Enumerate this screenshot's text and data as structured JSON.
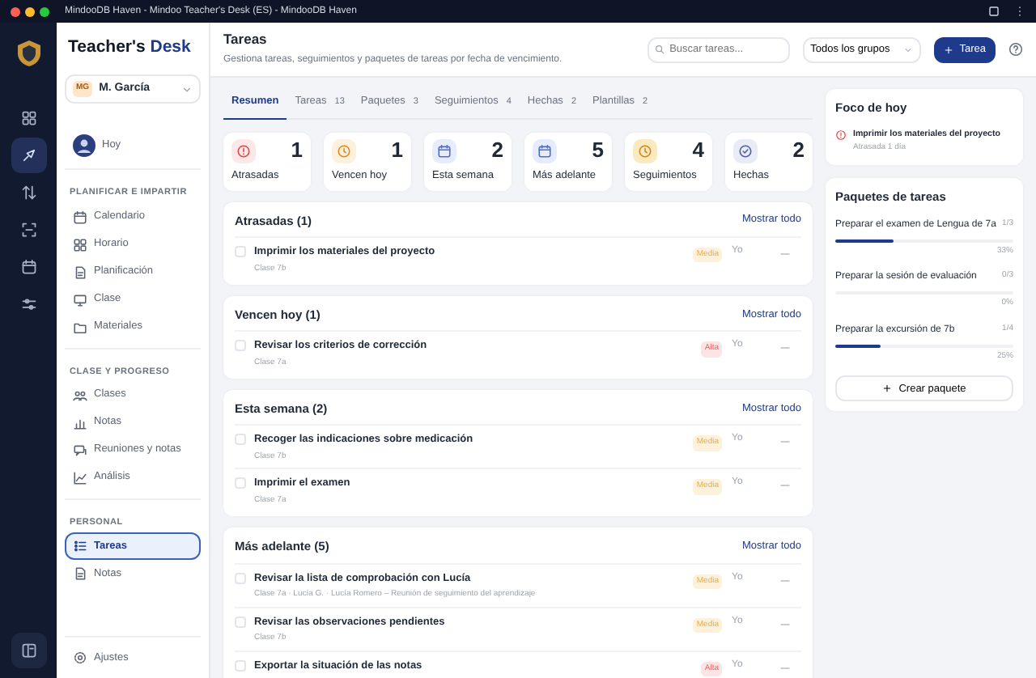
{
  "window": {
    "title": "MindooDB Haven - Mindoo Teacher's Desk (ES) - MindooDB Haven"
  },
  "rail": [
    {
      "selected": false
    },
    {
      "selected": true
    },
    {
      "selected": false
    },
    {
      "selected": false
    },
    {
      "selected": false
    },
    {
      "selected": false
    }
  ],
  "sidebar": {
    "brand_first": "Teacher's",
    "brand_second": "Desk",
    "user": {
      "initials": "MG",
      "name": "M. García"
    },
    "today": "Hoy",
    "sections": [
      {
        "heading": "PLANIFICAR E IMPARTIR",
        "items": [
          {
            "label": "Calendario",
            "selected": false
          },
          {
            "label": "Horario",
            "selected": false
          },
          {
            "label": "Planificación",
            "selected": false
          },
          {
            "label": "Clase",
            "selected": false
          },
          {
            "label": "Materiales",
            "selected": false
          }
        ]
      },
      {
        "heading": "CLASE Y PROGRESO",
        "items": [
          {
            "label": "Clases",
            "selected": false
          },
          {
            "label": "Notas",
            "selected": false
          },
          {
            "label": "Reuniones y notas",
            "selected": false
          },
          {
            "label": "Análisis",
            "selected": false
          }
        ]
      },
      {
        "heading": "PERSONAL",
        "items": [
          {
            "label": "Tareas",
            "selected": true
          },
          {
            "label": "Notas",
            "selected": false
          }
        ]
      }
    ],
    "settings": "Ajustes"
  },
  "header": {
    "title": "Tareas",
    "subtitle": "Gestiona tareas, seguimientos y paquetes de tareas por fecha de vencimiento.",
    "search": {
      "placeholder": "Buscar tareas..."
    },
    "group_filter": "Todos los grupos",
    "new_button": "Tarea"
  },
  "tabs": [
    {
      "label": "Resumen",
      "selected": true
    },
    {
      "label": "Tareas",
      "count": "13",
      "selected": false
    },
    {
      "label": "Paquetes",
      "count": "3",
      "selected": false
    },
    {
      "label": "Seguimientos",
      "count": "4",
      "selected": false
    },
    {
      "label": "Hechas",
      "count": "2",
      "selected": false
    },
    {
      "label": "Plantillas",
      "count": "2",
      "selected": false
    }
  ],
  "stats": [
    {
      "kind": "overdue",
      "label": "Atrasadas",
      "value": "1"
    },
    {
      "kind": "today",
      "label": "Vencen hoy",
      "value": "1"
    },
    {
      "kind": "week",
      "label": "Esta semana",
      "value": "2"
    },
    {
      "kind": "later",
      "label": "Más adelante",
      "value": "5"
    },
    {
      "kind": "followup",
      "label": "Seguimientos",
      "value": "4"
    },
    {
      "kind": "done",
      "label": "Hechas",
      "value": "2"
    }
  ],
  "sections": [
    {
      "title": "Atrasadas (1)",
      "action": "Mostrar todo",
      "tasks": [
        {
          "title": "Imprimir los materiales del proyecto",
          "meta": "Clase 7b",
          "priority": "Media",
          "color": "#fdf1dc",
          "owner": "Yo",
          "done": false
        }
      ]
    },
    {
      "title": "Vencen hoy (1)",
      "action": "Mostrar todo",
      "tasks": [
        {
          "title": "Revisar los criterios de corrección",
          "meta": "Clase 7a",
          "priority": "Alta",
          "color": "#fde4e4",
          "owner": "Yo",
          "done": false
        }
      ]
    },
    {
      "title": "Esta semana (2)",
      "action": "Mostrar todo",
      "tasks": [
        {
          "title": "Recoger las indicaciones sobre medicación",
          "meta": "Clase 7b",
          "priority": "Media",
          "color": "#fdf1dc",
          "owner": "Yo",
          "done": false
        },
        {
          "title": "Imprimir el examen",
          "meta": "Clase 7a",
          "priority": "Media",
          "color": "#fdf1dc",
          "owner": "Yo",
          "done": false
        }
      ]
    },
    {
      "title": "Más adelante (5)",
      "action": "Mostrar todo",
      "tasks": [
        {
          "title": "Revisar la lista de comprobación con Lucía",
          "meta": "Clase 7a · Lucía G. · Lucía Romero – Reunión de seguimiento del aprendizaje",
          "priority": "Media",
          "color": "#fdf1dc",
          "owner": "Yo",
          "done": false
        },
        {
          "title": "Revisar las observaciones pendientes",
          "meta": "Clase 7b",
          "priority": "Media",
          "color": "#fdf1dc",
          "owner": "Yo",
          "done": false
        },
        {
          "title": "Exportar la situación de las notas",
          "priority": "Alta",
          "color": "#fde4e4",
          "owner": "Yo",
          "done": false
        }
      ]
    }
  ],
  "focus": {
    "title": "Foco de hoy",
    "items": [
      {
        "title": "Imprimir los materiales del proyecto",
        "meta": "Atrasada 1 día"
      }
    ]
  },
  "packages": {
    "title": "Paquetes de tareas",
    "items": [
      {
        "name": "Preparar el examen de Lengua de 7a",
        "count": "1/3",
        "level": 0.33,
        "percent": "33%"
      },
      {
        "name": "Preparar la sesión de evaluación",
        "count": "0/3",
        "level": 0,
        "percent": "0%"
      },
      {
        "name": "Preparar la excursión de 7b",
        "count": "1/4",
        "level": 0.25,
        "percent": "25%"
      }
    ],
    "create_button": "Crear paquete"
  }
}
